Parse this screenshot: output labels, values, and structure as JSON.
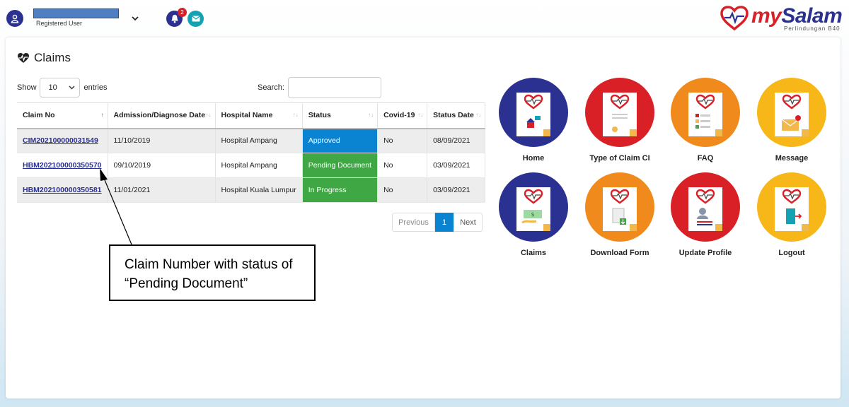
{
  "header": {
    "user_role": "Registered User",
    "notification_count": "2",
    "brand_my": "my",
    "brand_salam": "Salam",
    "brand_sub": "Perlindungan B40"
  },
  "claims": {
    "title": "Claims",
    "show_label": "Show",
    "entries_value": "10",
    "entries_label": "entries",
    "search_label": "Search:",
    "columns": [
      "Claim No",
      "Admission/Diagnose Date",
      "Hospital Name",
      "Status",
      "Covid-19",
      "Status Date"
    ],
    "rows": [
      {
        "claim_no": "CIM202100000031549",
        "date": "11/10/2019",
        "hospital": "Hospital Ampang",
        "status": "Approved",
        "covid": "No",
        "status_date": "08/09/2021"
      },
      {
        "claim_no": "HBM202100000350570",
        "date": "09/10/2019",
        "hospital": "Hospital Ampang",
        "status": "Pending Document",
        "covid": "No",
        "status_date": "03/09/2021"
      },
      {
        "claim_no": "HBM202100000350581",
        "date": "11/01/2021",
        "hospital": "Hospital Kuala Lumpur",
        "status": "In Progress",
        "covid": "No",
        "status_date": "03/09/2021"
      }
    ],
    "pager": {
      "previous": "Previous",
      "page": "1",
      "next": "Next"
    }
  },
  "menu": [
    {
      "label": "Home",
      "color": "#2b3190"
    },
    {
      "label": "Type of Claim CI",
      "color": "#d92027"
    },
    {
      "label": "FAQ",
      "color": "#f08a1c"
    },
    {
      "label": "Message",
      "color": "#f7b718"
    },
    {
      "label": "Claims",
      "color": "#2b3190"
    },
    {
      "label": "Download Form",
      "color": "#f08a1c"
    },
    {
      "label": "Update Profile",
      "color": "#d92027"
    },
    {
      "label": "Logout",
      "color": "#f7b718"
    }
  ],
  "annotation": {
    "line1": "Claim Number with status of",
    "line2": "“Pending Document”"
  }
}
